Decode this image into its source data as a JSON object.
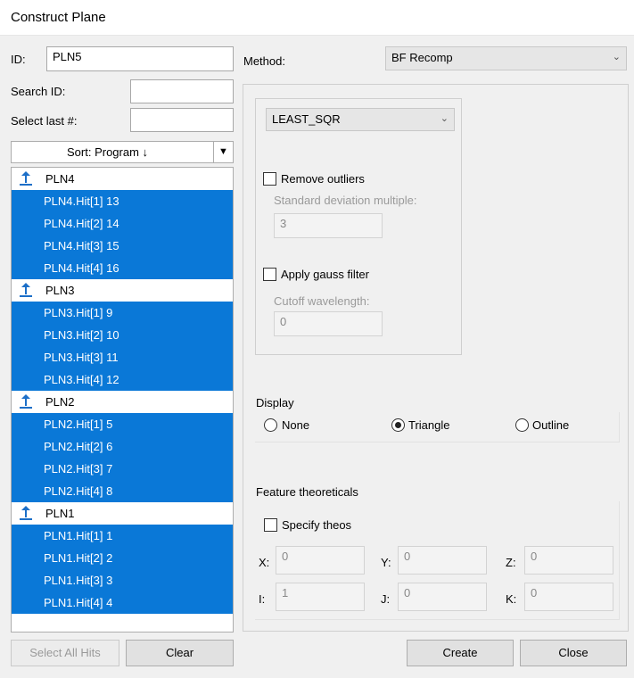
{
  "window": {
    "title": "Construct Plane"
  },
  "id_field": {
    "label": "ID:",
    "value": "PLN5"
  },
  "search_id": {
    "label": "Search ID:",
    "value": ""
  },
  "select_last": {
    "label": "Select last #:",
    "value": ""
  },
  "sort": {
    "label": "Sort: Program ↓"
  },
  "tree": [
    {
      "name": "PLN4",
      "hits": [
        "PLN4.Hit[1] 13",
        "PLN4.Hit[2] 14",
        "PLN4.Hit[3] 15",
        "PLN4.Hit[4] 16"
      ]
    },
    {
      "name": "PLN3",
      "hits": [
        "PLN3.Hit[1] 9",
        "PLN3.Hit[2] 10",
        "PLN3.Hit[3] 11",
        "PLN3.Hit[4] 12"
      ]
    },
    {
      "name": "PLN2",
      "hits": [
        "PLN2.Hit[1] 5",
        "PLN2.Hit[2] 6",
        "PLN2.Hit[3] 7",
        "PLN2.Hit[4] 8"
      ]
    },
    {
      "name": "PLN1",
      "hits": [
        "PLN1.Hit[1] 1",
        "PLN1.Hit[2] 2",
        "PLN1.Hit[3] 3",
        "PLN1.Hit[4] 4"
      ]
    }
  ],
  "method": {
    "label": "Method:",
    "value": "BF Recomp"
  },
  "fit": {
    "algorithm": "LEAST_SQR",
    "remove_outliers": "Remove outliers",
    "std_dev_label": "Standard deviation multiple:",
    "std_dev_value": "3",
    "gauss_filter": "Apply gauss filter",
    "cutoff_label": "Cutoff wavelength:",
    "cutoff_value": "0"
  },
  "display": {
    "label": "Display",
    "options": [
      "None",
      "Triangle",
      "Outline"
    ],
    "selected": "Triangle"
  },
  "theoreticals": {
    "label": "Feature theoreticals",
    "specify": "Specify theos",
    "x_label": "X:",
    "x": "0",
    "y_label": "Y:",
    "y": "0",
    "z_label": "Z:",
    "z": "0",
    "i_label": "I:",
    "i": "1",
    "j_label": "J:",
    "j": "0",
    "k_label": "K:",
    "k": "0"
  },
  "buttons": {
    "select_all_hits": "Select All Hits",
    "clear": "Clear",
    "create": "Create",
    "close": "Close"
  },
  "colors": {
    "selection": "#0a78d7"
  }
}
